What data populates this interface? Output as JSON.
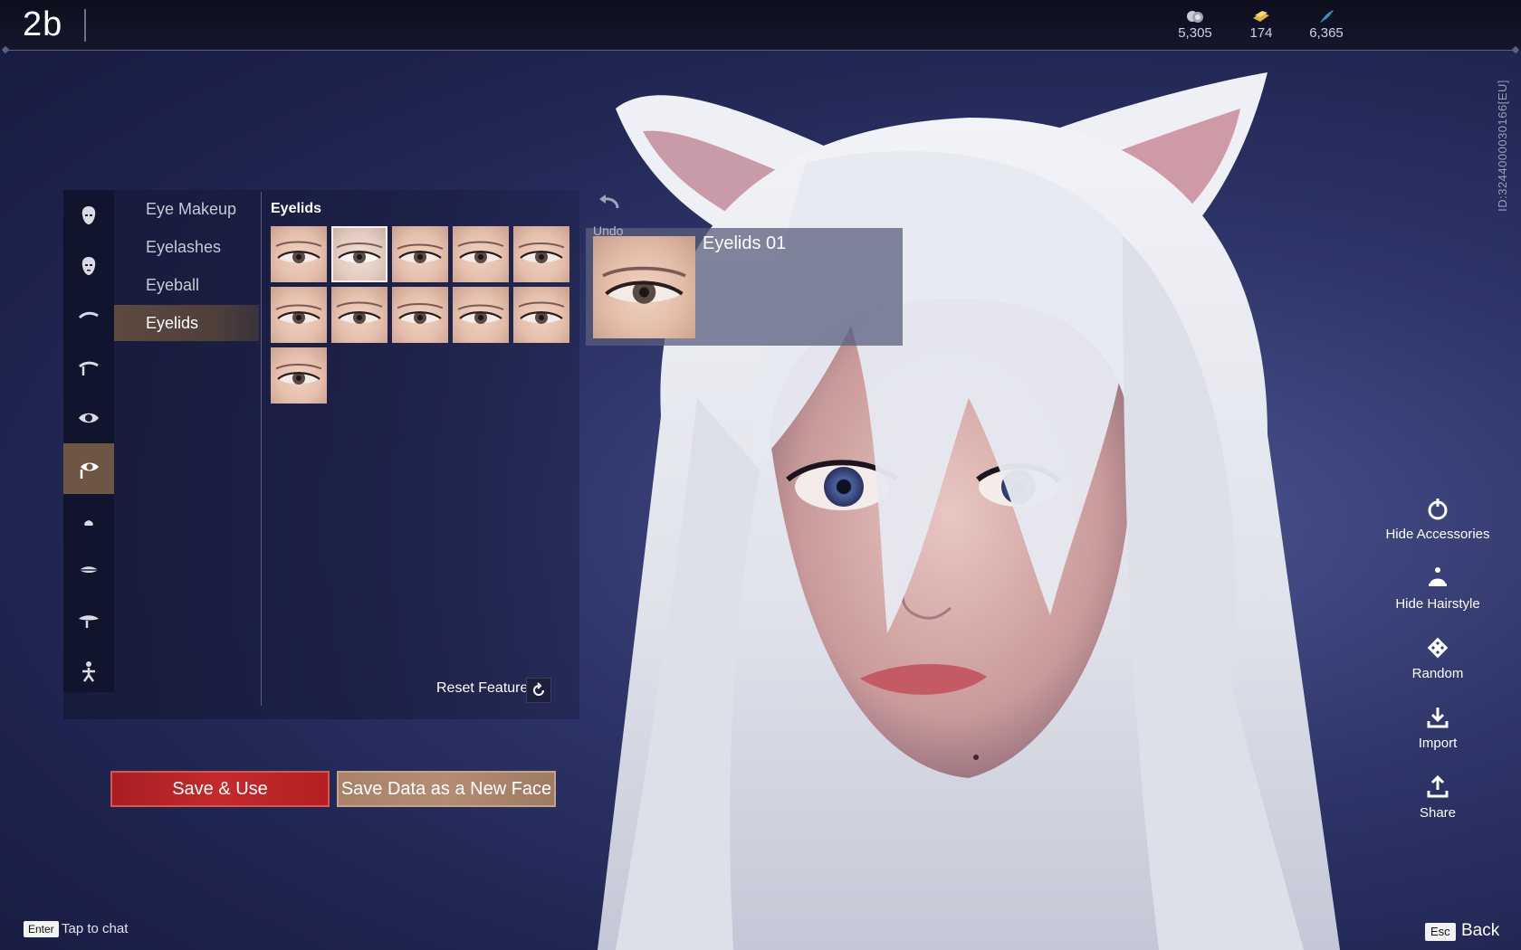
{
  "header": {
    "title": "2b",
    "currencies": [
      {
        "icon": "silver-coin-icon",
        "value": "5,305"
      },
      {
        "icon": "gold-ticket-icon",
        "value": "174"
      },
      {
        "icon": "feather-crystal-icon",
        "value": "6,365"
      }
    ]
  },
  "sidebar": {
    "categories": [
      {
        "icon": "head-shape-icon"
      },
      {
        "icon": "face-shape-icon"
      },
      {
        "icon": "eyebrow-icon"
      },
      {
        "icon": "brow-bone-icon"
      },
      {
        "icon": "eye-icon"
      },
      {
        "icon": "eye-makeup-icon",
        "active": true
      },
      {
        "icon": "nose-icon"
      },
      {
        "icon": "lips-icon"
      },
      {
        "icon": "mustache-icon"
      },
      {
        "icon": "body-icon"
      }
    ],
    "sub_items": [
      {
        "label": "Eye Makeup"
      },
      {
        "label": "Eyelashes"
      },
      {
        "label": "Eyeball"
      },
      {
        "label": "Eyelids",
        "active": true
      }
    ]
  },
  "grid": {
    "title": "Eyelids",
    "thumb_count": 11,
    "selected_index": 1
  },
  "reset": {
    "label": "Reset Feature"
  },
  "preview": {
    "undo_label": "Undo",
    "name": "Eyelids 01"
  },
  "buttons": {
    "save_use": "Save & Use",
    "save_new": "Save Data as a New Face"
  },
  "actions": [
    {
      "icon": "hide-accessories-icon",
      "label": "Hide Accessories"
    },
    {
      "icon": "hide-hairstyle-icon",
      "label": "Hide Hairstyle"
    },
    {
      "icon": "random-dice-icon",
      "label": "Random"
    },
    {
      "icon": "import-icon",
      "label": "Import"
    },
    {
      "icon": "share-icon",
      "label": "Share"
    }
  ],
  "side_id": "ID:3244000030166[EU]",
  "footer": {
    "enter_key": "Enter",
    "chat_hint": "Tap to chat",
    "esc_key": "Esc",
    "back": "Back"
  },
  "colors": {
    "background": "#2e3569",
    "save_button": "#c52a2c",
    "new_face_button": "#b28c73",
    "active_tab": "#6e5644"
  }
}
